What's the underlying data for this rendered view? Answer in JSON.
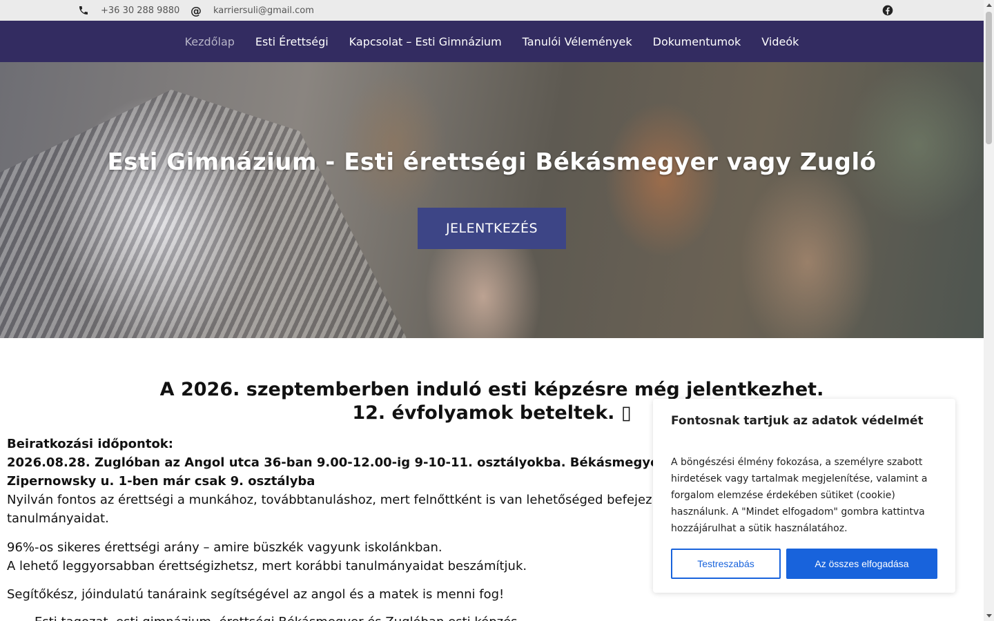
{
  "topbar": {
    "phone": "+36 30 288 9880",
    "at_symbol": "@",
    "email": "karriersuli@gmail.com",
    "icons": [
      "phone-icon",
      "at-icon",
      "facebook-icon"
    ]
  },
  "nav": {
    "items": [
      {
        "label": "Kezdőlap",
        "active": true
      },
      {
        "label": "Esti Érettségi"
      },
      {
        "label": "Kapcsolat – Esti Gimnázium"
      },
      {
        "label": "Tanulói Vélemények"
      },
      {
        "label": "Dokumentumok"
      },
      {
        "label": "Videók"
      }
    ]
  },
  "hero": {
    "title": "Esti Gimnázium - Esti érettségi Békásmegyer vagy Zugló",
    "cta_label": "JELENTKEZÉS"
  },
  "main": {
    "headline_line1": "A 2026. szeptemberben induló esti képzésre még jelentkezhet.",
    "headline_line2": "12. évfolyamok beteltek. ",
    "enrollment_title": "Beiratkozási időpontok:",
    "enrollment_line1": "2026.08.28. Zuglóban az Angol utca 36-ban 9.00-12.00-ig 9-10-11. osztályokba. Békásmegyeren a",
    "enrollment_line2": "Zipernowsky u. 1-ben már csak 9. osztályba",
    "intro_line1": "Nyilván fontos az érettségi a munkához, továbbtanuláshoz, mert felnőttként is van lehetőséged befejezni",
    "intro_line2": "tanulmányaidat.",
    "rate_line": "96%-os sikeres érettségi arány – amire büszkék vagyunk iskolánkban.",
    "fast_line": "A lehető leggyorsabban érettségizhetsz, mert korábbi tanulmányaidat beszámítjuk.",
    "teachers_line": "Segítőkész, jóindulatú tanáraink segítségével az angol és a matek is menni fog!",
    "list_partial": "Esti tagozat, esti gimnázium, érettségi Békásmegyer és Zuglóban esti képzés"
  },
  "cookie": {
    "title": "Fontosnak tartjuk az adatok védelmét",
    "text": "A böngészési élmény fokozása, a személyre szabott hirdetések vagy tartalmak megjelenítése, valamint a forgalom elemzése érdekében sütiket (cookie) használunk. A \"Mindet elfogadom\" gombra kattintva hozzájárulhat a sütik használatához.",
    "customize_label": "Testreszabás",
    "accept_label": "Az összes elfogadása",
    "accent": "#1863dc"
  },
  "colors": {
    "nav_bg": "#332c61",
    "cta_bg": "#3d4586",
    "topbar_bg": "#ebebeb"
  }
}
